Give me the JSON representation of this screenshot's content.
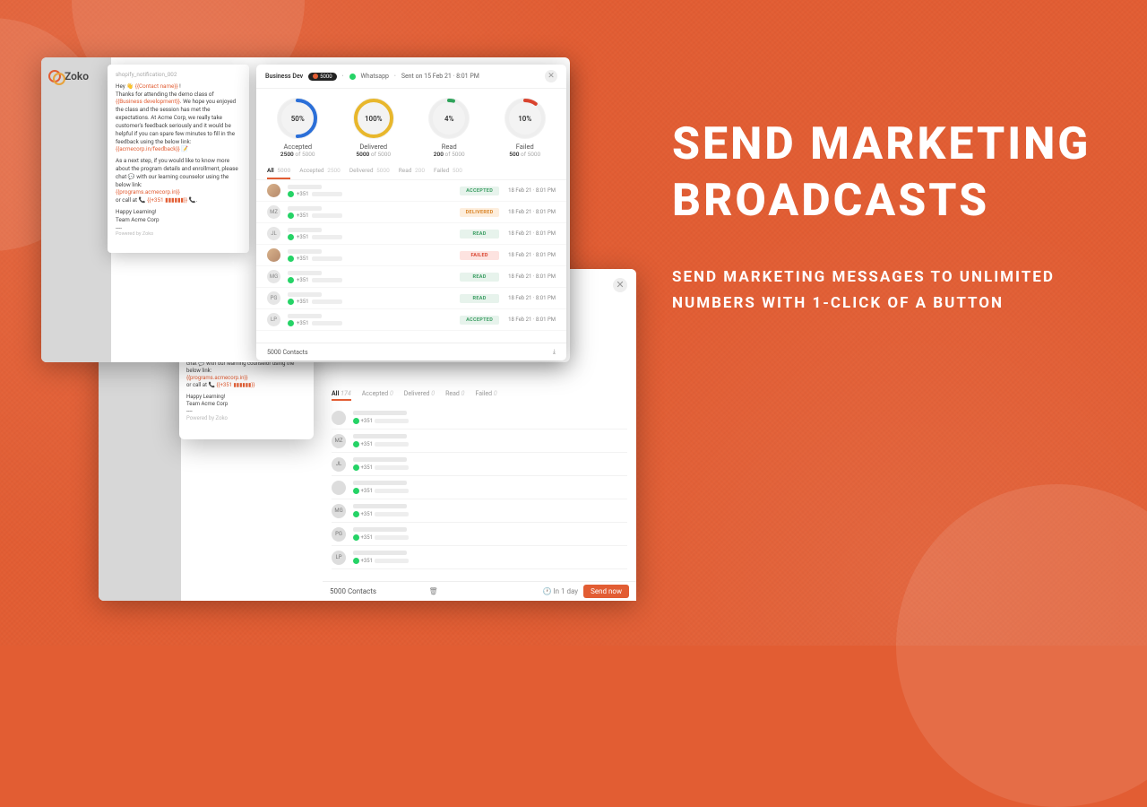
{
  "hero": {
    "title": "SEND MARKETING BROADCASTS",
    "subtitle": "SEND MARKETING MESSAGES TO UNLIMITED NUMBERS WITH 1-CLICK OF A BUTTON"
  },
  "brand": "Zoko",
  "template": {
    "id": "shopify_notification_002",
    "greeting_prefix": "Hey 👋 ",
    "greeting_var": "{{Contact name}}",
    "greeting_suffix": " !",
    "line1": "Thanks for attending the demo class of",
    "var_course": "{{Business development}}",
    "body1": ". We hope you enjoyed the class and the session has met the expectations. At Acme Corp, we really take customer's feedback seriously and it would be helpful if you can spare few minutes to fill in the feedback using the below link: ",
    "feedback_link": "{{acmecorp.in/feedback}}",
    "emoji": " 📝",
    "body2": "As a next step, if you would like to know more about the program details and enrollment, please chat 💬 with our learning counselor using the below link:",
    "program_link": "{{programs.acmecorp.in}}",
    "call_prefix": "or call at  📞 ",
    "call_var": "{{+351 ▮▮▮▮▮▮}}",
    "call_suffix": " 📞.",
    "signoff1": "Happy Learning!",
    "signoff2": "Team Acme Corp",
    "divider": "----",
    "powered": "Powered by Zoko"
  },
  "dash": {
    "title": "Business Dev",
    "count_pill": "5000",
    "channel": "Whatsapp",
    "sent_at": "Sent on 15 Feb 21 · 8:01 PM",
    "gauges": [
      {
        "label": "Accepted",
        "pct": "50%",
        "value": "2500",
        "total": "5000",
        "color": "#2b6fd8",
        "frac": 0.5
      },
      {
        "label": "Delivered",
        "pct": "100%",
        "value": "5000",
        "total": "5000",
        "color": "#e8b72c",
        "frac": 1.0
      },
      {
        "label": "Read",
        "pct": "4%",
        "value": "200",
        "total": "5000",
        "color": "#2fa35a",
        "frac": 0.04
      },
      {
        "label": "Failed",
        "pct": "10%",
        "value": "500",
        "total": "5000",
        "color": "#d9432e",
        "frac": 0.1
      }
    ],
    "tabs": [
      {
        "label": "All",
        "count": "5000",
        "active": true
      },
      {
        "label": "Accepted",
        "count": "2500"
      },
      {
        "label": "Delivered",
        "count": "5000"
      },
      {
        "label": "Read",
        "count": "200"
      },
      {
        "label": "Failed",
        "count": "500"
      }
    ],
    "of": " of ",
    "rows": [
      {
        "avatar": "",
        "img": true,
        "phone": "+351",
        "status": "ACCEPTED",
        "cls": "b-acc",
        "ts": "18 Feb 21 · 8:01 PM"
      },
      {
        "avatar": "MZ",
        "phone": "+351",
        "status": "DELIVERED",
        "cls": "b-del",
        "ts": "18 Feb 21 · 8:01 PM"
      },
      {
        "avatar": "JL",
        "phone": "+351",
        "status": "READ",
        "cls": "b-read",
        "ts": "18 Feb 21 · 8:01 PM"
      },
      {
        "avatar": "",
        "img": true,
        "phone": "+351",
        "status": "FAILED",
        "cls": "b-fail",
        "ts": "18 Feb 21 · 8:01 PM"
      },
      {
        "avatar": "MG",
        "phone": "+351",
        "status": "READ",
        "cls": "b-read",
        "ts": "18 Feb 21 · 8:01 PM"
      },
      {
        "avatar": "PG",
        "phone": "+351",
        "status": "READ",
        "cls": "b-read",
        "ts": "18 Feb 21 · 8:01 PM"
      },
      {
        "avatar": "LP",
        "phone": "+351",
        "status": "ACCEPTED",
        "cls": "b-acc",
        "ts": "18 Feb 21 · 8:01 PM"
      }
    ],
    "footer_count": "5000 Contacts",
    "download_glyph": "⤓"
  },
  "back": {
    "tabs": [
      {
        "label": "All",
        "count": "174",
        "active": true
      },
      {
        "label": "Accepted",
        "count": "0"
      },
      {
        "label": "Delivered",
        "count": "0"
      },
      {
        "label": "Read",
        "count": "0"
      },
      {
        "label": "Failed",
        "count": "0"
      }
    ],
    "rows": [
      {
        "avatar": "",
        "img": true,
        "phone": "+351"
      },
      {
        "avatar": "MZ",
        "phone": "+351"
      },
      {
        "avatar": "JL",
        "phone": "+351"
      },
      {
        "avatar": "",
        "img": true,
        "phone": "+351"
      },
      {
        "avatar": "MG",
        "phone": "+351"
      },
      {
        "avatar": "PG",
        "phone": "+351"
      },
      {
        "avatar": "LP",
        "phone": "+351"
      }
    ],
    "footer_count": "5000 Contacts",
    "trash_glyph": "🗑",
    "schedule": "In 1 day",
    "clock_glyph": "🕐",
    "send_label": "Send now"
  }
}
